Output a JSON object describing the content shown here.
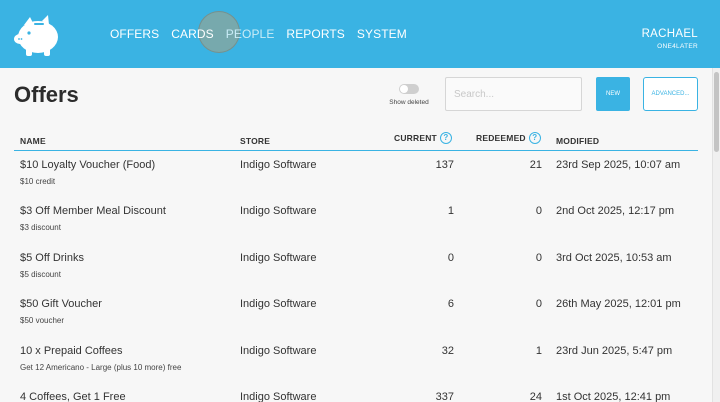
{
  "nav": {
    "items": [
      {
        "label": "OFFERS"
      },
      {
        "label": "CARDS"
      },
      {
        "label": "PEOPLE"
      },
      {
        "label": "REPORTS"
      },
      {
        "label": "SYSTEM"
      }
    ],
    "active": "PEOPLE"
  },
  "user": {
    "name": "RACHAEL",
    "org": "ONE4LATER"
  },
  "page": {
    "title": "Offers"
  },
  "controls": {
    "toggle_label": "Show deleted",
    "toggle_on": false,
    "search_placeholder": "Search...",
    "search_value": "",
    "new_label": "NEW",
    "advanced_label": "ADVANCED..."
  },
  "table": {
    "headers": {
      "name": "NAME",
      "store": "STORE",
      "current": "CURRENT",
      "redeemed": "REDEEMED",
      "modified": "MODIFIED"
    },
    "rows": [
      {
        "name": "$10 Loyalty Voucher (Food)",
        "sub": "$10 credit",
        "store": "Indigo Software",
        "current": "137",
        "redeemed": "21",
        "modified": "23rd Sep 2025, 10:07 am"
      },
      {
        "name": "$3 Off Member Meal Discount",
        "sub": "$3 discount",
        "store": "Indigo Software",
        "current": "1",
        "redeemed": "0",
        "modified": "2nd Oct 2025, 12:17 pm"
      },
      {
        "name": "$5 Off Drinks",
        "sub": "$5 discount",
        "store": "Indigo Software",
        "current": "0",
        "redeemed": "0",
        "modified": "3rd Oct 2025, 10:53 am"
      },
      {
        "name": "$50 Gift Voucher",
        "sub": "$50 voucher",
        "store": "Indigo Software",
        "current": "6",
        "redeemed": "0",
        "modified": "26th May 2025, 12:01 pm"
      },
      {
        "name": "10 x Prepaid Coffees",
        "sub": "Get 12 Americano - Large (plus 10 more) free",
        "store": "Indigo Software",
        "current": "32",
        "redeemed": "1",
        "modified": "23rd Jun 2025, 5:47 pm"
      },
      {
        "name": "4 Coffees, Get 1 Free",
        "sub": "",
        "store": "Indigo Software",
        "current": "337",
        "redeemed": "24",
        "modified": "1st Oct 2025, 12:41 pm"
      }
    ]
  },
  "colors": {
    "accent": "#3ab3e3",
    "background": "#f7f7f7"
  }
}
